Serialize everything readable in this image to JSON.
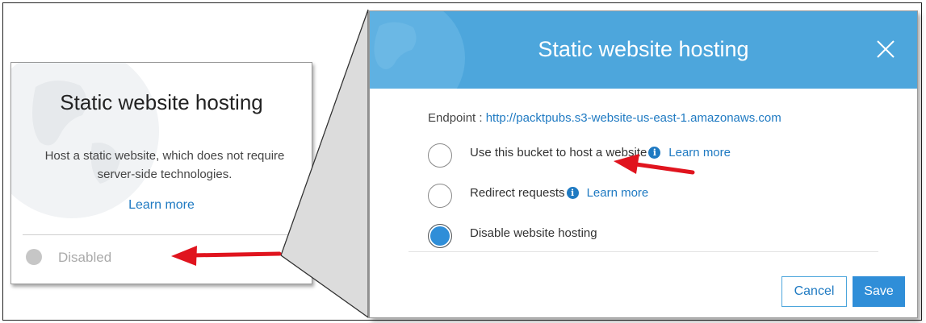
{
  "card": {
    "title": "Static website hosting",
    "description": "Host a static website, which does not require server-side technologies.",
    "learn_more": "Learn more",
    "status": "Disabled"
  },
  "modal": {
    "title": "Static website hosting",
    "endpoint_label": "Endpoint : ",
    "endpoint_url": "http://packtpubs.s3-website-us-east-1.amazonaws.com",
    "options": [
      {
        "label": "Use this bucket to host a website",
        "has_info": true,
        "link": "Learn more",
        "selected": false
      },
      {
        "label": "Redirect requests",
        "has_info": true,
        "link": "Learn more",
        "selected": false
      },
      {
        "label": "Disable website hosting",
        "has_info": false,
        "link": "",
        "selected": true
      }
    ],
    "cancel_label": "Cancel",
    "save_label": "Save"
  },
  "colors": {
    "header_blue": "#4da6dc",
    "link_blue": "#1f7ac2",
    "primary_button": "#2f8ed8",
    "annotation_arrow": "#e0141e"
  },
  "icons": [
    "globe-icon",
    "close-icon",
    "info-icon",
    "radio-icon",
    "status-dot-icon",
    "annotation-arrow"
  ]
}
